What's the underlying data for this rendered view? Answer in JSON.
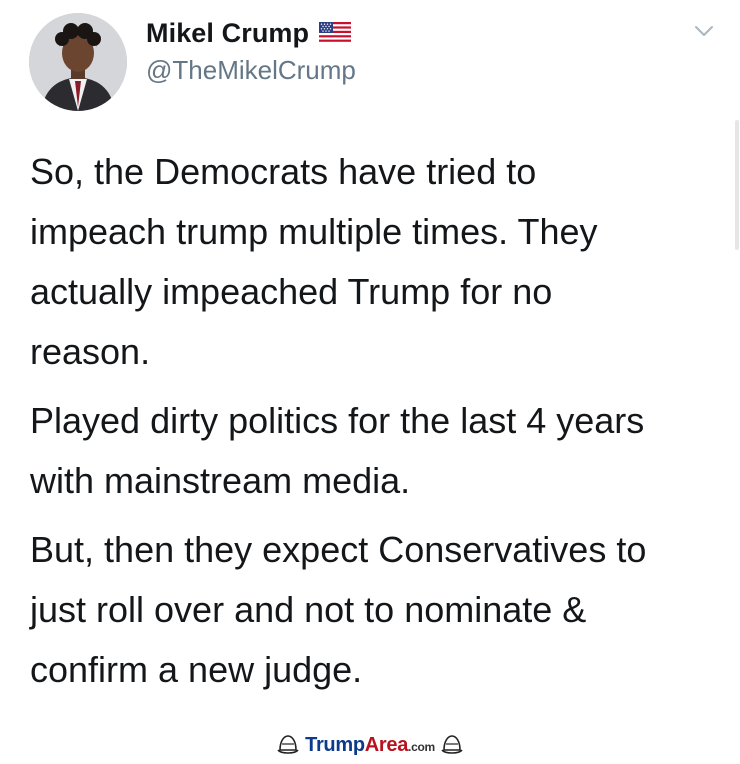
{
  "tweet": {
    "display_name": "Mikel Crump",
    "handle": "@TheMikelCrump",
    "flag_icon": "us-flag-icon",
    "menu_icon": "chevron-down-icon",
    "paragraphs": [
      "So, the Democrats have tried to\nimpeach trump multiple times. They\nactually impeached Trump for no\nreason.",
      "Played dirty politics for the last 4 years\nwith mainstream media.",
      "But, then they expect Conservatives to\njust roll over and not to nominate &\nconfirm a new judge."
    ]
  },
  "watermark": {
    "brand_part1": "Trump",
    "brand_part2": "Area",
    "brand_suffix": ".com",
    "icon": "hat-icon"
  },
  "colors": {
    "text": "#14171a",
    "handle": "#657786",
    "brand_blue": "#0c3b8c",
    "brand_red": "#b7121f"
  }
}
